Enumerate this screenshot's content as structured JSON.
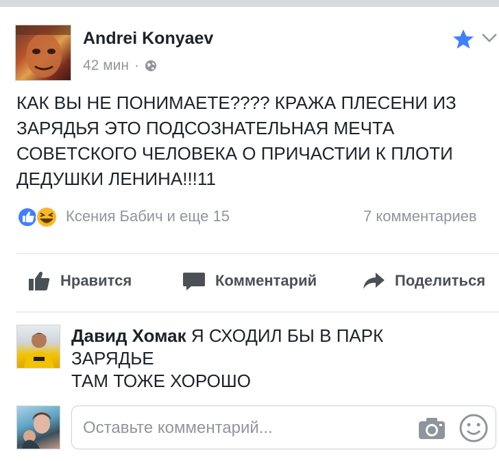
{
  "post": {
    "author": "Andrei Konyaev",
    "time": "42 мин",
    "separator": "·",
    "text_lines": [
      "КАК ВЫ НЕ ПОНИМАЕТЕ???? КРАЖА ПЛЕСЕНИ ИЗ",
      "ЗАРЯДЬЯ ЭТО ПОДСОЗНАТЕЛЬНАЯ МЕЧТА",
      "СОВЕТСКОГО ЧЕЛОВЕКА О ПРИЧАСТИИ К ПЛОТИ",
      "ДЕДУШКИ ЛЕНИНА!!!11"
    ],
    "reactions_text": "Ксения Бабич и еще 15",
    "comments_count": "7 комментариев"
  },
  "actions": {
    "like": "Нравится",
    "comment": "Комментарий",
    "share": "Поделиться"
  },
  "comment": {
    "author": "Давид Хомак",
    "text": "Я СХОДИЛ БЫ В ПАРК ЗАРЯДЬЕ ТАМ ТОЖЕ ХОРОШО",
    "text_lines": [
      "Я СХОДИЛ БЫ В ПАРК",
      "ЗАРЯДЬЕ",
      "ТАМ ТОЖЕ ХОРОШО"
    ]
  },
  "composer": {
    "placeholder": "Оставьте комментарий..."
  },
  "icons": {
    "globe": "globe-icon",
    "star": "star-icon",
    "chevron": "chevron-down-icon",
    "like": "thumbs-up-icon",
    "comment": "speech-bubble-icon",
    "share": "share-arrow-icon",
    "camera": "camera-icon",
    "emoji": "smiley-icon",
    "reaction_like": "like-reaction-icon",
    "reaction_haha": "haha-reaction-icon"
  },
  "colors": {
    "accent": "#4267b2",
    "star": "#4080ff",
    "secondary_text": "#90949c",
    "action_text": "#4b4f56",
    "haha": "#f7b928"
  }
}
